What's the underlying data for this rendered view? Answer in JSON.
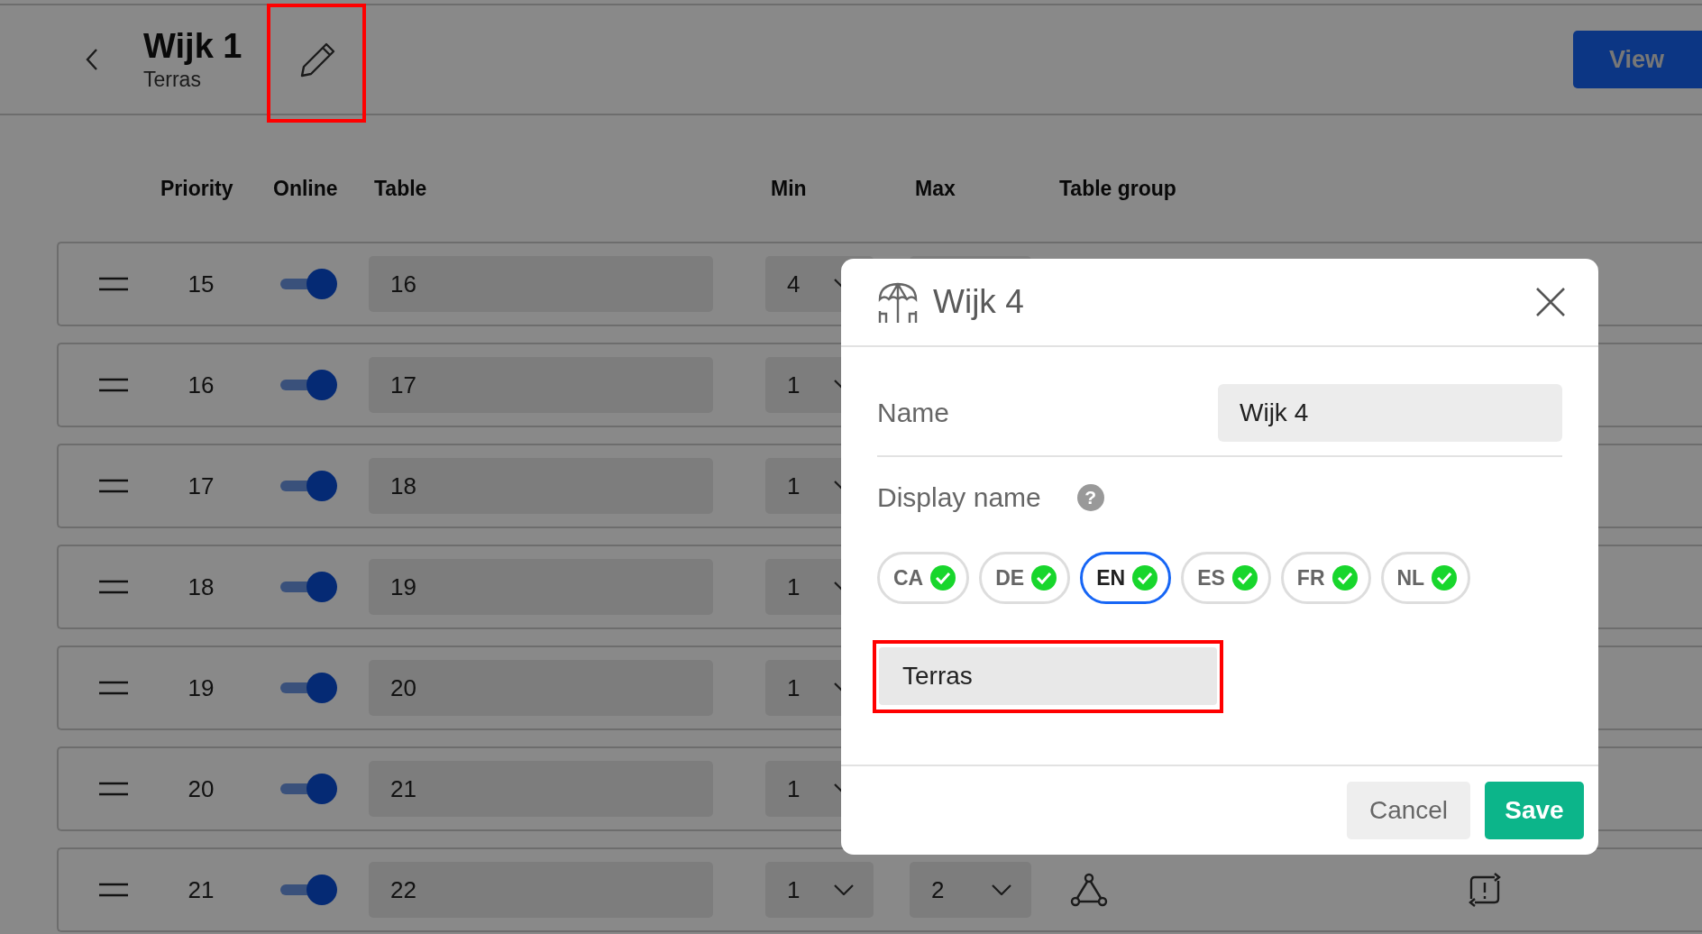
{
  "header": {
    "title": "Wijk 1",
    "subtitle": "Terras",
    "edit_highlighted": true,
    "view_button": "View"
  },
  "columns": [
    "Priority",
    "Online",
    "Table",
    "Min",
    "Max",
    "Table group"
  ],
  "rows": [
    {
      "priority": "15",
      "online": true,
      "table": "16",
      "min": "4"
    },
    {
      "priority": "16",
      "online": true,
      "table": "17",
      "min": "1"
    },
    {
      "priority": "17",
      "online": true,
      "table": "18",
      "min": "1"
    },
    {
      "priority": "18",
      "online": true,
      "table": "19",
      "min": "1"
    },
    {
      "priority": "19",
      "online": true,
      "table": "20",
      "min": "1"
    },
    {
      "priority": "20",
      "online": true,
      "table": "21",
      "min": "1"
    },
    {
      "priority": "21",
      "online": true,
      "table": "22",
      "min": "1",
      "max": "2"
    }
  ],
  "modal": {
    "title": "Wijk 4",
    "name_label": "Name",
    "name_value": "Wijk 4",
    "display_label": "Display name",
    "help_icon": "?",
    "languages": [
      {
        "code": "CA",
        "selected": false,
        "complete": true
      },
      {
        "code": "DE",
        "selected": false,
        "complete": true
      },
      {
        "code": "EN",
        "selected": true,
        "complete": true
      },
      {
        "code": "ES",
        "selected": false,
        "complete": true
      },
      {
        "code": "FR",
        "selected": false,
        "complete": true
      },
      {
        "code": "NL",
        "selected": false,
        "complete": true
      }
    ],
    "display_value": "Terras",
    "display_highlighted": true,
    "cancel": "Cancel",
    "save": "Save"
  }
}
